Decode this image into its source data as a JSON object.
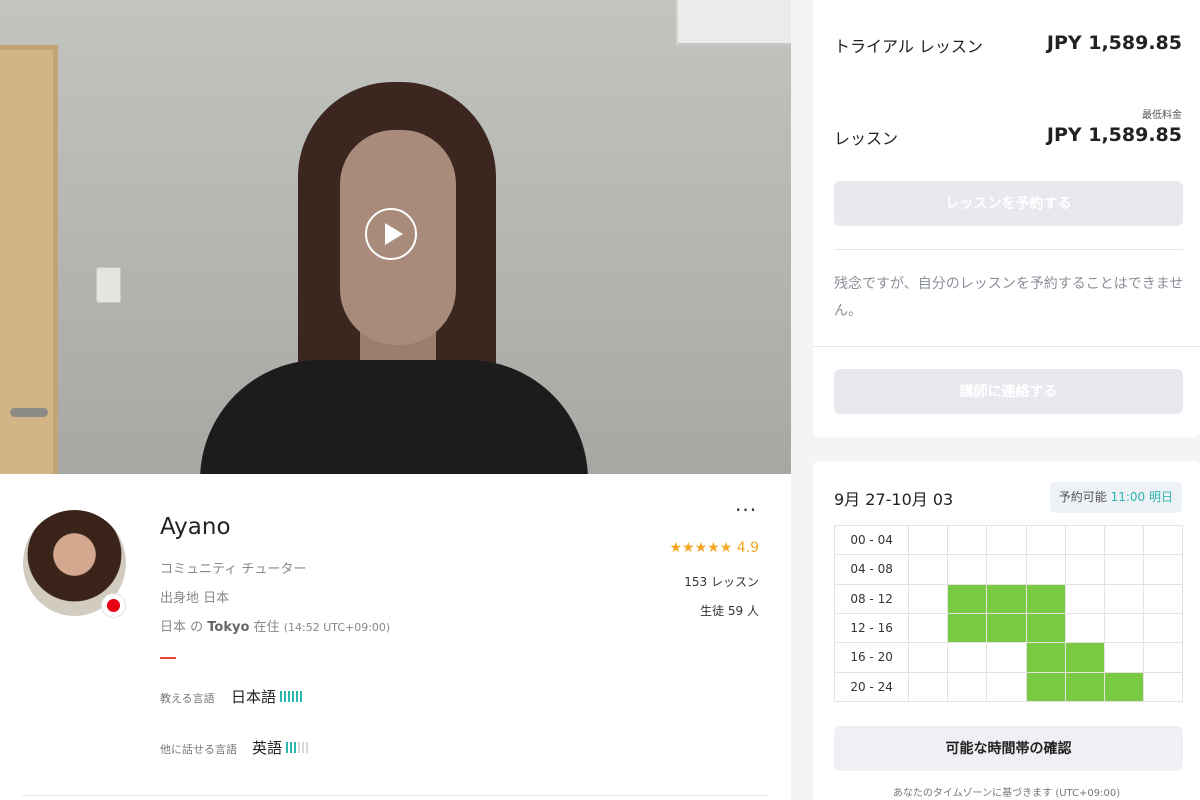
{
  "pricing": {
    "trial_label": "トライアル レッスン",
    "trial_price": "JPY 1,589.85",
    "min_price_label": "最低料金",
    "lesson_label": "レッスン",
    "lesson_price": "JPY 1,589.85",
    "book_button": "レッスンを予約する",
    "notice": "残念ですが、自分のレッスンを予約することはできません。",
    "contact_button": "講師に連絡する"
  },
  "profile": {
    "name": "Ayano",
    "role": "コミュニティ チューター",
    "origin_prefix": "出身地",
    "origin_value": "日本",
    "residence_country": "日本 の",
    "residence_city": "Tokyo",
    "residence_suffix": "在住",
    "local_time": "(14:52 UTC+09:00)",
    "rating": "4.9",
    "lessons": "153 レッスン",
    "students_prefix": "生徒",
    "students_value": "59 人",
    "more_menu": "···",
    "teaches_label": "教える言語",
    "teaches_value": "日本語",
    "teaches_level": 6,
    "speaks_label": "他に話せる言語",
    "speaks_value": "英語",
    "speaks_level": 3
  },
  "schedule": {
    "week": "9月 27-10月 03",
    "available_label": "予約可能",
    "available_time": "11:00",
    "available_day": "明日",
    "time_slots": [
      "00 - 04",
      "04 - 08",
      "08 - 12",
      "12 - 16",
      "16 - 20",
      "20 - 24"
    ],
    "availability": [
      [
        0,
        0,
        0,
        0,
        0,
        0,
        0
      ],
      [
        0,
        0,
        0,
        0,
        0,
        0,
        0
      ],
      [
        0,
        1,
        1,
        1,
        0,
        0,
        0
      ],
      [
        0,
        1,
        1,
        1,
        0,
        0,
        0
      ],
      [
        0,
        0,
        0,
        1,
        1,
        0,
        0
      ],
      [
        0,
        0,
        0,
        1,
        1,
        1,
        0
      ]
    ],
    "check_button": "可能な時間帯の確認",
    "timezone_note": "あなたのタイムゾーンに基づきます (UTC+09:00)"
  },
  "colors": {
    "accent_teal": "#2bb6b0",
    "available_green": "#7ac943",
    "star_gold": "#f5a623",
    "flag_red": "#e60012"
  },
  "icons": {
    "play": "play-circle-icon",
    "star": "star-icon",
    "more": "more-horizontal-icon",
    "flag": "japan-flag-icon"
  }
}
